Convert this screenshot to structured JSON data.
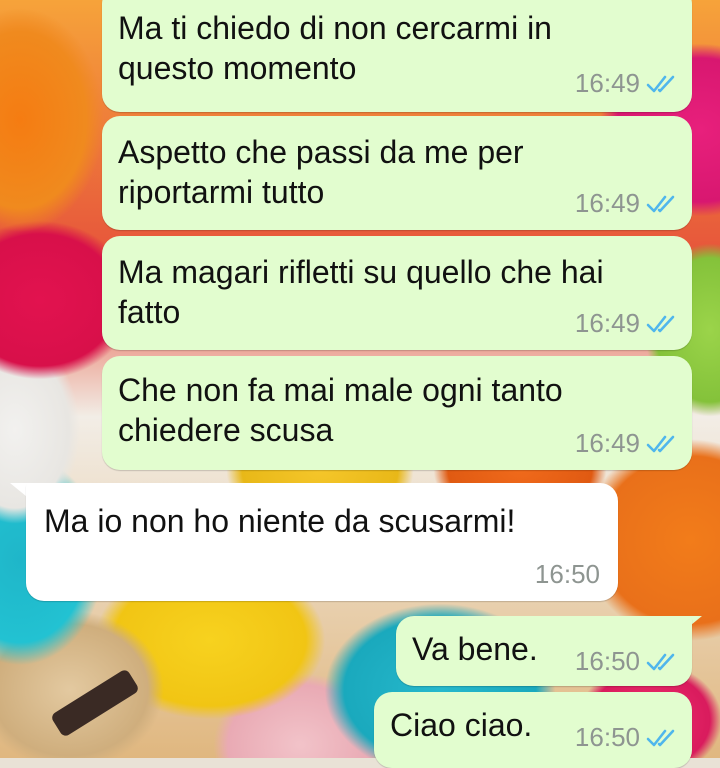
{
  "messages": [
    {
      "direction": "outgoing",
      "text": "Ma ti chiedo di non cercarmi in\nquesto momento",
      "time": "16:49",
      "status_icon": "double-check-read-icon"
    },
    {
      "direction": "outgoing",
      "text": "Aspetto che passi da me per\nriportarmi tutto",
      "time": "16:49",
      "status_icon": "double-check-read-icon"
    },
    {
      "direction": "outgoing",
      "text": "Ma magari rifletti su quello che hai\nfatto",
      "time": "16:49",
      "status_icon": "double-check-read-icon"
    },
    {
      "direction": "outgoing",
      "text": "Che non fa mai male ogni tanto\nchiedere scusa",
      "time": "16:49",
      "status_icon": "double-check-read-icon"
    },
    {
      "direction": "incoming",
      "text": "Ma io non ho niente da scusarmi!",
      "time": "16:50"
    },
    {
      "direction": "outgoing",
      "text": "Va bene.",
      "time": "16:50",
      "status_icon": "double-check-read-icon"
    },
    {
      "direction": "outgoing",
      "text": "Ciao ciao.",
      "time": "16:50",
      "status_icon": "double-check-read-icon"
    }
  ],
  "colors": {
    "outgoing_bubble": "#e2fdcf",
    "incoming_bubble": "#ffffff",
    "read_ticks": "#4fb6ec",
    "timestamp": "#8e9591",
    "wallpaper_theme": "colorful macarons"
  }
}
